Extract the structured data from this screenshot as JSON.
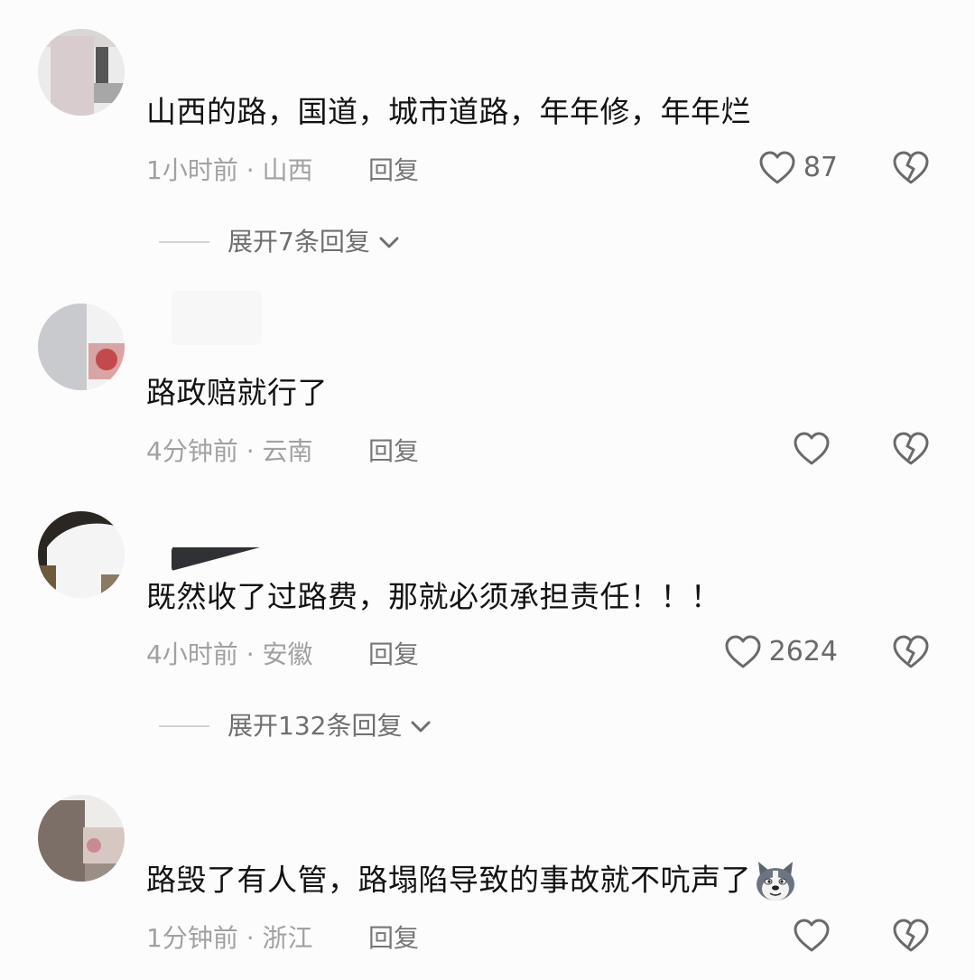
{
  "comments": [
    {
      "text": "山西的路，国道，城市道路，年年修，年年烂",
      "time_location": "1小时前 · 山西",
      "reply_label": "回复",
      "likes": "87",
      "expand_label": "展开7条回复"
    },
    {
      "text": "路政赔就行了",
      "time_location": "4分钟前 · 云南",
      "reply_label": "回复",
      "likes": ""
    },
    {
      "text": "既然收了过路费，那就必须承担责任！！！",
      "time_location": "4小时前 · 安徽",
      "reply_label": "回复",
      "likes": "2624",
      "expand_label": "展开132条回复"
    },
    {
      "text": "路毁了有人管，路塌陷导致的事故就不吭声了",
      "time_location": "1分钟前 · 浙江",
      "reply_label": "回复",
      "likes": "",
      "emoji_icon": "husky-dog-emoji-icon"
    }
  ],
  "icons": {
    "like": "heart-outline-icon",
    "dislike": "broken-heart-icon",
    "expand": "chevron-down-icon"
  },
  "colors": {
    "text": "#121212",
    "meta": "#a1a1a1",
    "icon": "#6a6a6a",
    "background": "#fcfcfc"
  }
}
